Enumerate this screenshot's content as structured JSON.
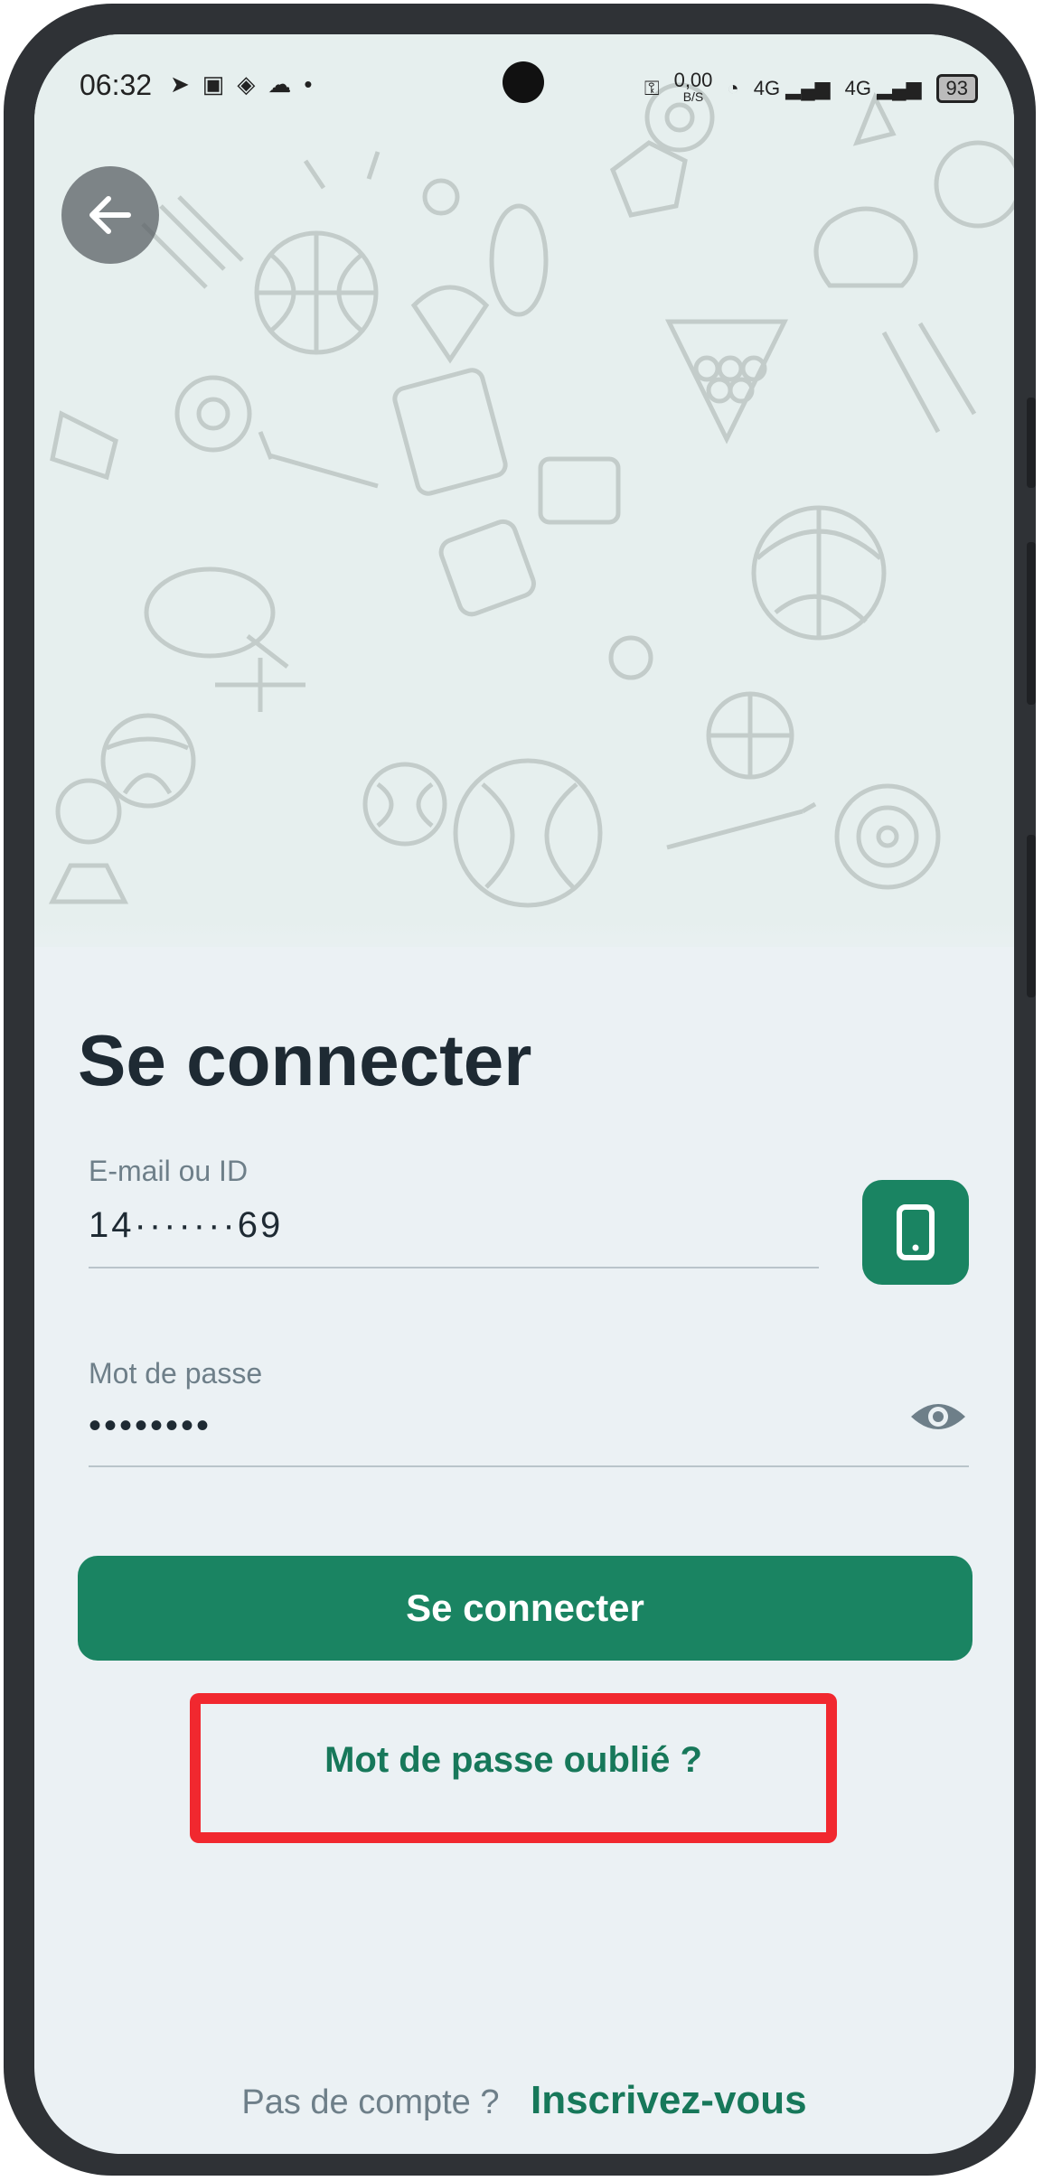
{
  "status_bar": {
    "time": "06:32",
    "net_speed": "0,00",
    "net_unit": "B/S",
    "signal_1": "4G",
    "signal_2": "4G",
    "battery": "93"
  },
  "login": {
    "title": "Se connecter",
    "email_label": "E-mail ou ID",
    "email_value": "14·······69",
    "password_label": "Mot de passe",
    "password_value": "••••••••",
    "submit_label": "Se connecter",
    "forgot_label": "Mot de passe oublié ?",
    "no_account_label": "Pas de compte ?",
    "signup_label": "Inscrivez-vous"
  },
  "icons": {
    "back": "arrow-left-icon",
    "phone_toggle": "smartphone-icon",
    "password_visibility": "eye-icon"
  },
  "colors": {
    "accent": "#1a8462",
    "highlight": "#f1282f",
    "title": "#1e2a33",
    "pattern_bg": "#e6efee"
  }
}
